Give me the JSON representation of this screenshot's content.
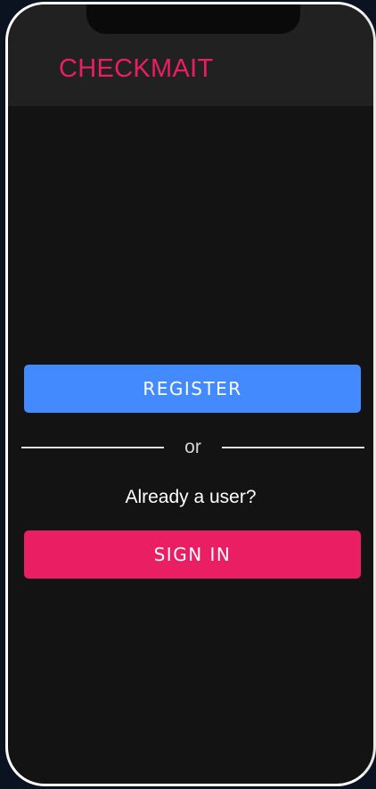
{
  "header": {
    "title": "CHECKMAIT"
  },
  "auth": {
    "register_label": "REGISTER",
    "divider_text": "or",
    "prompt_text": "Already a user?",
    "signin_label": "SIGN IN"
  },
  "colors": {
    "brand": "#e91e63",
    "register_button": "#448aff",
    "signin_button": "#e91e63",
    "background": "#131313",
    "header_background": "#212121"
  }
}
